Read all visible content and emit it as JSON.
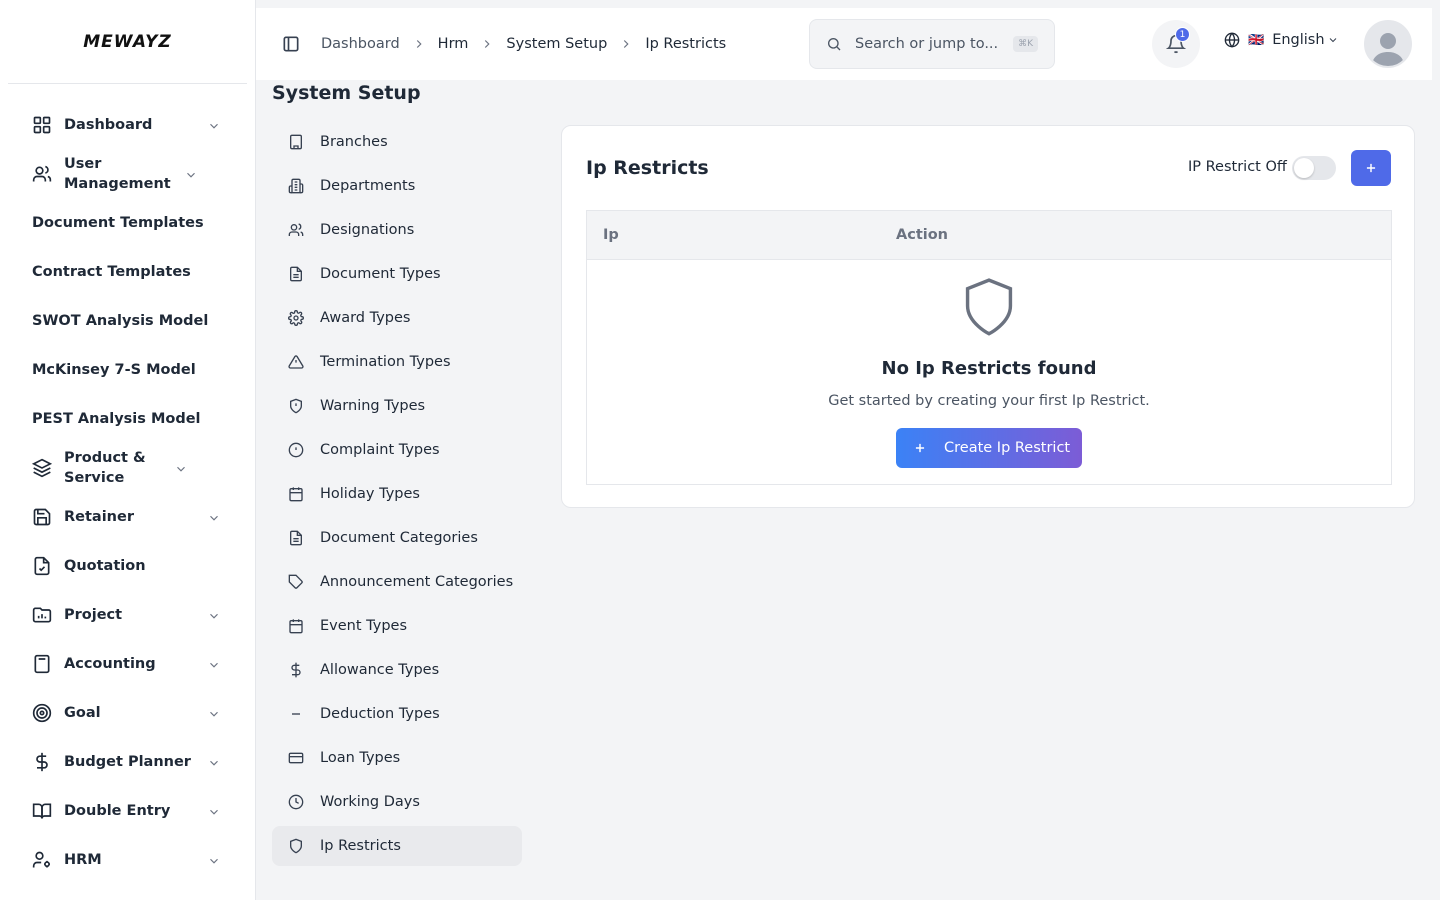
{
  "app": {
    "logo_text": "MEWAYZ"
  },
  "sidebar": {
    "items": [
      {
        "label": "Dashboard",
        "icon": "dashboard-grid-icon",
        "has_chevron": true
      },
      {
        "label": "User Management",
        "icon": "users-icon",
        "has_chevron": true
      },
      {
        "label": "Document Templates",
        "icon": "",
        "has_chevron": false
      },
      {
        "label": "Contract Templates",
        "icon": "",
        "has_chevron": false
      },
      {
        "label": "SWOT Analysis Model",
        "icon": "",
        "has_chevron": false
      },
      {
        "label": "McKinsey 7-S Model",
        "icon": "",
        "has_chevron": false
      },
      {
        "label": "PEST Analysis Model",
        "icon": "",
        "has_chevron": false
      },
      {
        "label": "Product & Service",
        "icon": "layers-icon",
        "has_chevron": true
      },
      {
        "label": "Retainer",
        "icon": "save-icon",
        "has_chevron": true
      },
      {
        "label": "Quotation",
        "icon": "file-check-icon",
        "has_chevron": false
      },
      {
        "label": "Project",
        "icon": "folder-chart-icon",
        "has_chevron": true
      },
      {
        "label": "Accounting",
        "icon": "calculator-icon",
        "has_chevron": true
      },
      {
        "label": "Goal",
        "icon": "target-icon",
        "has_chevron": true
      },
      {
        "label": "Budget Planner",
        "icon": "dollar-icon",
        "has_chevron": true
      },
      {
        "label": "Double Entry",
        "icon": "book-icon",
        "has_chevron": true
      },
      {
        "label": "HRM",
        "icon": "user-cog-icon",
        "has_chevron": true
      }
    ]
  },
  "topbar": {
    "breadcrumb": [
      "Dashboard",
      "Hrm",
      "System Setup",
      "Ip Restricts"
    ],
    "search_placeholder": "Search or jump to...",
    "search_shortcut": "⌘K",
    "notification_count": "1",
    "language": "English",
    "language_flag": "🇬🇧"
  },
  "page": {
    "title": "System Setup"
  },
  "setup_menu": {
    "items": [
      {
        "label": "Branches",
        "icon": "building-icon"
      },
      {
        "label": "Departments",
        "icon": "building-2-icon"
      },
      {
        "label": "Designations",
        "icon": "users-icon"
      },
      {
        "label": "Document Types",
        "icon": "file-text-icon"
      },
      {
        "label": "Award Types",
        "icon": "gear-icon"
      },
      {
        "label": "Termination Types",
        "icon": "alert-triangle-icon"
      },
      {
        "label": "Warning Types",
        "icon": "shield-alert-icon"
      },
      {
        "label": "Complaint Types",
        "icon": "alert-circle-icon"
      },
      {
        "label": "Holiday Types",
        "icon": "calendar-icon"
      },
      {
        "label": "Document Categories",
        "icon": "file-text-icon"
      },
      {
        "label": "Announcement Categories",
        "icon": "tag-icon"
      },
      {
        "label": "Event Types",
        "icon": "calendar-icon"
      },
      {
        "label": "Allowance Types",
        "icon": "dollar-icon"
      },
      {
        "label": "Deduction Types",
        "icon": "minus-icon"
      },
      {
        "label": "Loan Types",
        "icon": "credit-card-icon"
      },
      {
        "label": "Working Days",
        "icon": "clock-icon"
      },
      {
        "label": "Ip Restricts",
        "icon": "shield-icon",
        "active": true
      }
    ]
  },
  "card": {
    "title": "Ip Restricts",
    "restrict_label": "IP Restrict Off",
    "restrict_on": false,
    "add_label": "+",
    "columns": [
      "Ip",
      "Action"
    ],
    "empty_title": "No Ip Restricts found",
    "empty_subtitle": "Get started by creating your first Ip Restrict.",
    "create_label": "Create Ip Restrict"
  },
  "colors": {
    "accent": "#4f6ae8",
    "gradient_start": "#3b82f6",
    "gradient_end": "#7c5cd6"
  }
}
